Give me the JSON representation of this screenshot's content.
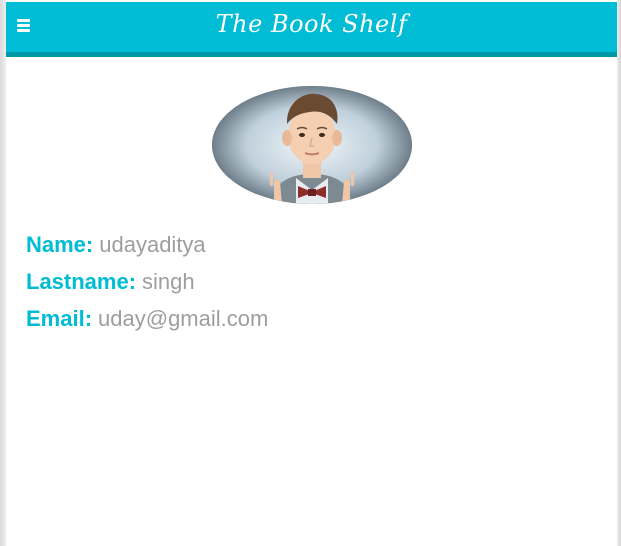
{
  "app": {
    "title": "The Book Shelf",
    "menu_icon": "hamburger-menu-icon",
    "accent_color": "#00bcd4",
    "accent_dark": "#0097a7"
  },
  "profile": {
    "avatar_alt": "profile photo",
    "fields": [
      {
        "label": "Name:",
        "value": "udayaditya"
      },
      {
        "label": "Lastname:",
        "value": "singh"
      },
      {
        "label": "Email:",
        "value": "uday@gmail.com"
      }
    ],
    "label_color": "#00bcd4",
    "value_color": "#9e9e9e"
  }
}
